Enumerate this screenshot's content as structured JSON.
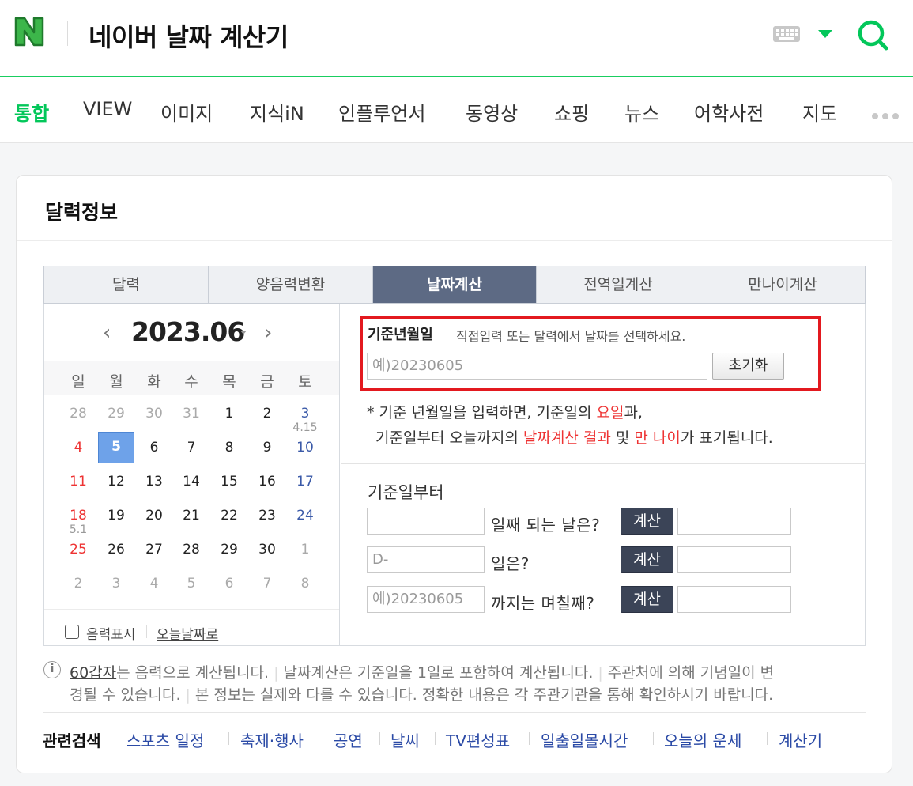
{
  "header": {
    "logo": "N",
    "query": "네이버 날짜 계산기"
  },
  "colors": {
    "brand": "#03c75a",
    "tool_tab_active": "#5d6a84",
    "highlight_box": "#e3191f",
    "link": "#2b4aa6"
  },
  "nav_tabs": [
    "통합",
    "VIEW",
    "이미지",
    "지식iN",
    "인플루언서",
    "동영상",
    "쇼핑",
    "뉴스",
    "어학사전",
    "지도"
  ],
  "card_title": "달력정보",
  "tool_tabs": [
    "달력",
    "양음력변환",
    "날짜계산",
    "전역일계산",
    "만나이계산"
  ],
  "calendar": {
    "month": "2023.06",
    "weekdays": [
      "일",
      "월",
      "화",
      "수",
      "목",
      "금",
      "토"
    ],
    "weeks": [
      [
        "28",
        "29",
        "30",
        "31",
        "1",
        "2",
        "3"
      ],
      [
        "4",
        "5",
        "6",
        "7",
        "8",
        "9",
        "10"
      ],
      [
        "11",
        "12",
        "13",
        "14",
        "15",
        "16",
        "17"
      ],
      [
        "18",
        "19",
        "20",
        "21",
        "22",
        "23",
        "24"
      ],
      [
        "25",
        "26",
        "27",
        "28",
        "29",
        "30",
        "1"
      ],
      [
        "2",
        "3",
        "4",
        "5",
        "6",
        "7",
        "8"
      ]
    ],
    "lunar_marks": [
      {
        "week": 0,
        "day": 6,
        "text": "4.15"
      },
      {
        "week": 3,
        "day": 0,
        "text": "5.1"
      }
    ],
    "selected_day": "5",
    "lunar_checkbox_label": "음력표시",
    "today_link": "오늘날짜로"
  },
  "calc": {
    "base_label": "기준년월일",
    "base_help": "직접입력 또는 달력에서 날짜를 선택하세요.",
    "base_placeholder": "예)20230605",
    "reset_button": "초기화",
    "note_line1_prefix": "* 기준 년월일을 입력하면, 기준일의 ",
    "note_line1_red": "요일",
    "note_line1_suffix": "과,",
    "note_line2_prefix": "기준일부터 오늘까지의 ",
    "note_line2_red1": "날짜계산 결과",
    "note_line2_mid": " 및 ",
    "note_line2_red2": "만 나이",
    "note_line2_suffix": "가 표기됩니다.",
    "from_label": "기준일부터",
    "rows": [
      {
        "input_placeholder": "",
        "text": "일째 되는 날은?",
        "button": "계산"
      },
      {
        "input_placeholder": "D-",
        "text": "일은?",
        "button": "계산"
      },
      {
        "input_placeholder": "예)20230605",
        "text": "까지는 며칠째?",
        "button": "계산"
      }
    ]
  },
  "info": {
    "icon": "i",
    "line1_link": "60갑자",
    "line1_a": "는 음력으로 계산됩니다.",
    "line1_b": "날짜계산은 기준일을 1일로 포함하여 계산됩니다.",
    "line1_c": "주관처에 의해 기념일이 변",
    "line2_a": "경될 수 있습니다.",
    "line2_b": "본 정보는 실제와 다를 수 있습니다. 정확한 내용은 각 주관기관을 통해 확인하시기 바랍니다."
  },
  "related": {
    "title": "관련검색",
    "links": [
      "스포츠 일정",
      "축제·행사",
      "공연",
      "날씨",
      "TV편성표",
      "일출일몰시간",
      "오늘의 운세",
      "계산기"
    ]
  }
}
